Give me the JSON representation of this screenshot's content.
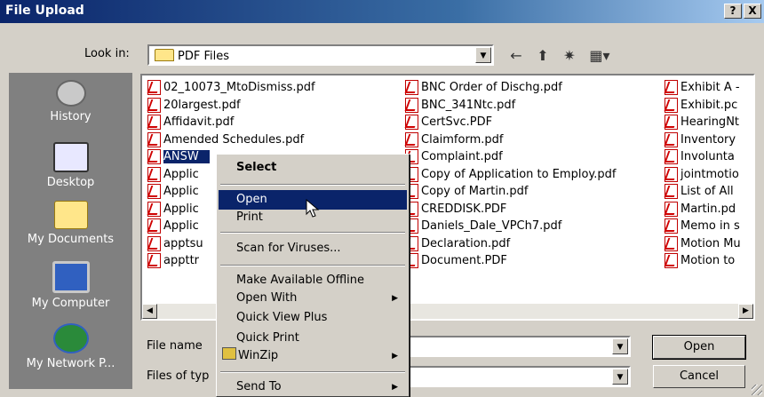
{
  "window": {
    "title": "File Upload",
    "help_btn": "?",
    "close_btn": "X"
  },
  "lookin": {
    "label": "Look in:",
    "value": "PDF Files"
  },
  "places": [
    {
      "label": "History",
      "icon": "history-icon"
    },
    {
      "label": "Desktop",
      "icon": "desktop-icon"
    },
    {
      "label": "My Documents",
      "icon": "my-documents-icon"
    },
    {
      "label": "My Computer",
      "icon": "my-computer-icon"
    },
    {
      "label": "My Network P...",
      "icon": "my-network-icon"
    }
  ],
  "files": {
    "col1": [
      "02_10073_MtoDismiss.pdf",
      "20largest.pdf",
      "Affidavit.pdf",
      "Amended Schedules.pdf",
      "ANSW",
      "Applic",
      "Applic",
      "Applic",
      "Applic",
      "apptsu",
      "appttr"
    ],
    "col2": [
      "BNC Order of Dischg.pdf",
      "BNC_341Ntc.pdf",
      "CertSvc.PDF",
      "Claimform.pdf",
      "Complaint.pdf",
      "Copy of Application to Employ.pdf",
      "Copy of Martin.pdf",
      "CREDDISK.PDF",
      "Daniels_Dale_VPCh7.pdf",
      "Declaration.pdf",
      "Document.PDF"
    ],
    "col3": [
      "Exhibit A -",
      "Exhibit.pc",
      "HearingNt",
      "Inventory",
      "Involunta",
      "jointmotio",
      "List of All",
      "Martin.pd",
      "Memo in s",
      "Motion Mu",
      "Motion to"
    ]
  },
  "filename": {
    "label": "File name",
    "value": ""
  },
  "filetype": {
    "label": "Files of typ",
    "value": ""
  },
  "buttons": {
    "open": "Open",
    "cancel": "Cancel"
  },
  "context_menu": {
    "items": [
      {
        "label": "Select",
        "bold": true
      },
      {
        "label": "Open",
        "highlighted": true
      },
      {
        "label": "Print"
      },
      {
        "label": "Scan for Viruses..."
      },
      {
        "label": "Make Available Offline"
      },
      {
        "label": "Open With",
        "submenu": true
      },
      {
        "label": "Quick View Plus"
      },
      {
        "label": "Quick Print"
      },
      {
        "label": "WinZip",
        "submenu": true,
        "icon": "winzip-icon"
      },
      {
        "label": "Send To",
        "submenu": true
      }
    ]
  },
  "colors": {
    "title_start": "#0a246a",
    "title_end": "#a6caf0",
    "face": "#d4d0c8",
    "highlight": "#0a246a"
  }
}
